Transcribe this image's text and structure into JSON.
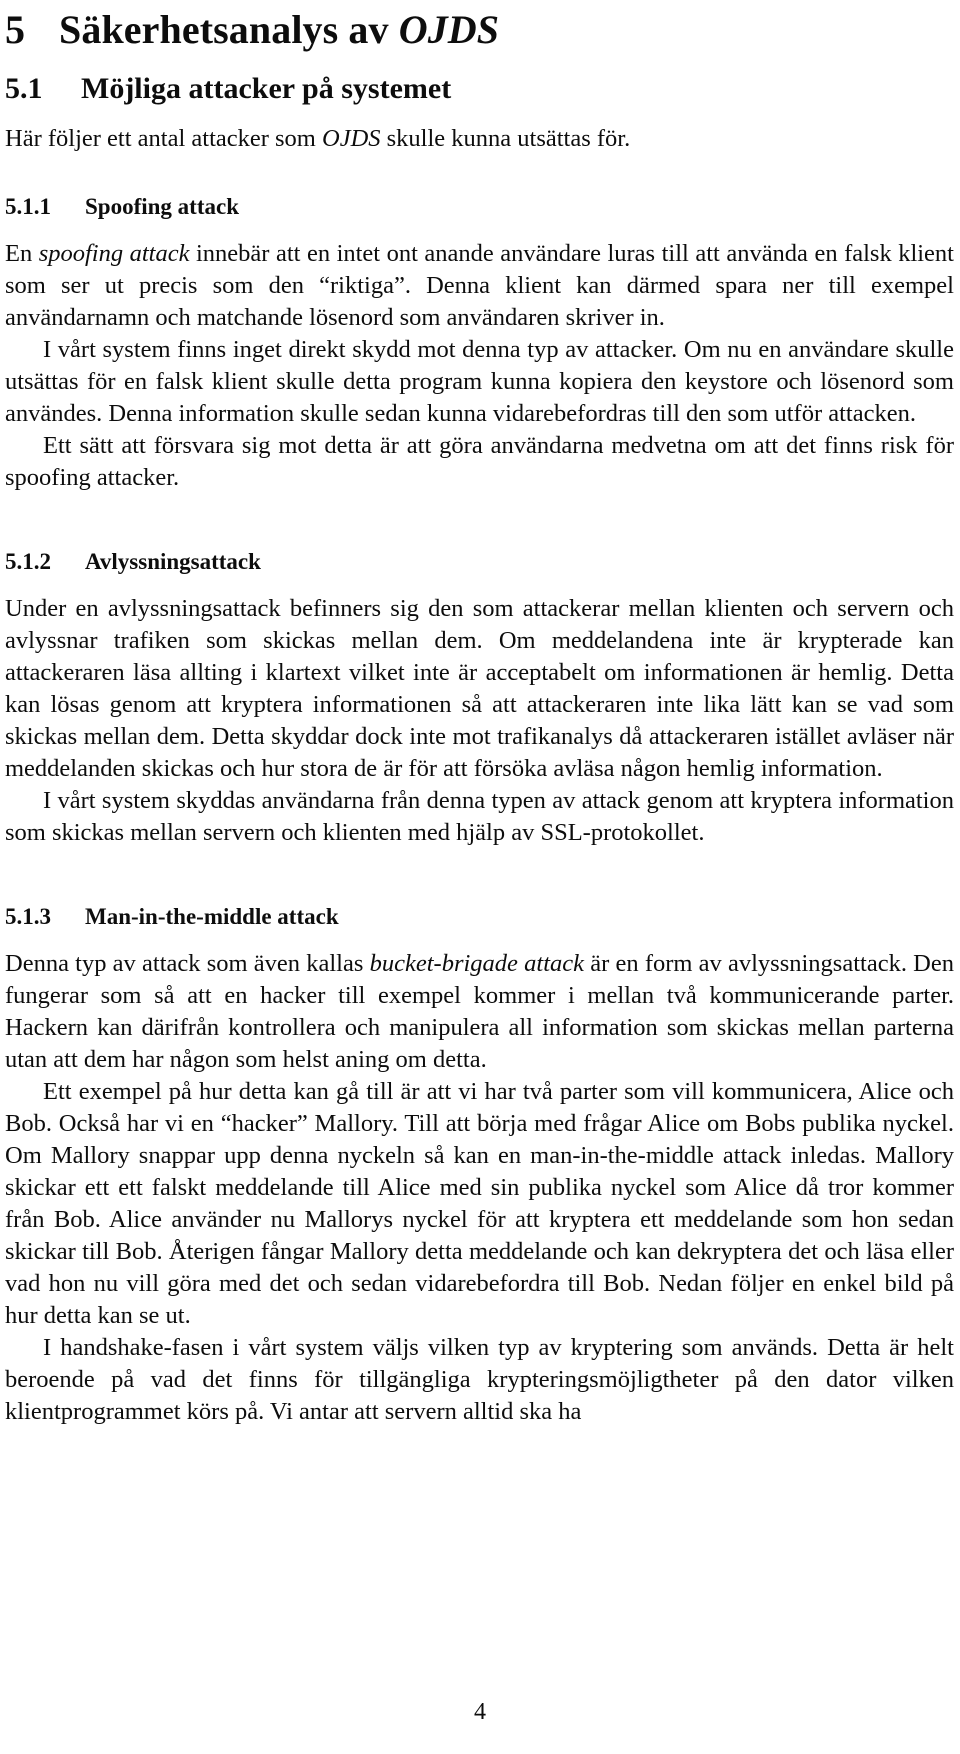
{
  "document": {
    "language": "sv",
    "page_number": "4"
  },
  "section": {
    "number": "5",
    "title_plain": "Säkerhetsanalys av ",
    "title_italic": "OJDS"
  },
  "subsection": {
    "number": "5.1",
    "title": "Möjliga attacker på systemet",
    "intro": "Här följer ett antal attacker som OJDS skulle kunna utsättas för.",
    "intro_pre": "Här följer ett antal attacker som ",
    "intro_italic": "OJDS",
    "intro_post": " skulle kunna utsättas för."
  },
  "subsubsections": [
    {
      "number": "5.1.1",
      "title": "Spoofing attack",
      "paragraphs": [
        {
          "indent": false,
          "pre": "En ",
          "italic": "spoofing attack",
          "post": " innebär att en intet ont anande användare luras till att använda en falsk klient som ser ut precis som den “riktiga”. Denna klient kan därmed spara ner till exempel användarnamn och matchande lösenord som användaren skriver in."
        },
        {
          "indent": true,
          "text": "I vårt system finns inget direkt skydd mot denna typ av attacker. Om nu en användare skulle utsättas för en falsk klient skulle detta program kunna kopiera den keystore och lösenord som användes. Denna information skulle sedan kunna vidarebefordras till den som utför attacken."
        },
        {
          "indent": true,
          "text": "Ett sätt att försvara sig mot detta är att göra användarna medvetna om att det finns risk för spoofing attacker."
        }
      ]
    },
    {
      "number": "5.1.2",
      "title": "Avlyssningsattack",
      "paragraphs": [
        {
          "indent": false,
          "text": "Under en avlyssningsattack befinners sig den som attackerar mellan klienten och servern och avlyssnar trafiken som skickas mellan dem. Om meddelandena inte är krypterade kan attackeraren läsa allting i klartext vilket inte är acceptabelt om informationen är hemlig. Detta kan lösas genom att kryptera informationen så att attackeraren inte lika lätt kan se vad som skickas mellan dem. Detta skyddar dock inte mot trafikanalys då attackeraren istället avläser när meddelanden skickas och hur stora de är för att försöka avläsa någon hemlig information."
        },
        {
          "indent": true,
          "text": "I vårt system skyddas användarna från denna typen av attack genom att kryptera information som skickas mellan servern och klienten med hjälp av SSL-protokollet."
        }
      ]
    },
    {
      "number": "5.1.3",
      "title": "Man-in-the-middle attack",
      "paragraphs": [
        {
          "indent": false,
          "pre": "Denna typ av attack som även kallas ",
          "italic": "bucket-brigade attack",
          "post": " är en form av avlyssningsattack. Den fungerar som så att en hacker till exempel kommer i mellan två kommunicerande parter. Hackern kan därifrån kontrollera och manipulera all information som skickas mellan parterna utan att dem har någon som helst aning om detta."
        },
        {
          "indent": true,
          "text": "Ett exempel på hur detta kan gå till är att vi har två parter som vill kommunicera, Alice och Bob. Också har vi en “hacker” Mallory. Till att börja med frågar Alice om Bobs publika nyckel. Om Mallory snappar upp denna nyckeln så kan en man-in-the-middle attack inledas. Mallory skickar ett ett falskt meddelande till Alice med sin publika nyckel som Alice då tror kommer från Bob. Alice använder nu Mallorys nyckel för att kryptera ett meddelande som hon sedan skickar till Bob. Återigen fångar Mallory detta meddelande och kan dekryptera det och läsa eller vad hon nu vill göra med det och sedan vidarebefordra till Bob. Nedan följer en enkel bild på hur detta kan se ut."
        },
        {
          "indent": true,
          "text": "I handshake-fasen i vårt system väljs vilken typ av kryptering som används. Detta är helt beroende på vad det finns för tillgängliga krypteringsmöjligtheter på den dator vilken klientprogrammet körs på. Vi antar att servern alltid ska ha"
        }
      ]
    }
  ]
}
